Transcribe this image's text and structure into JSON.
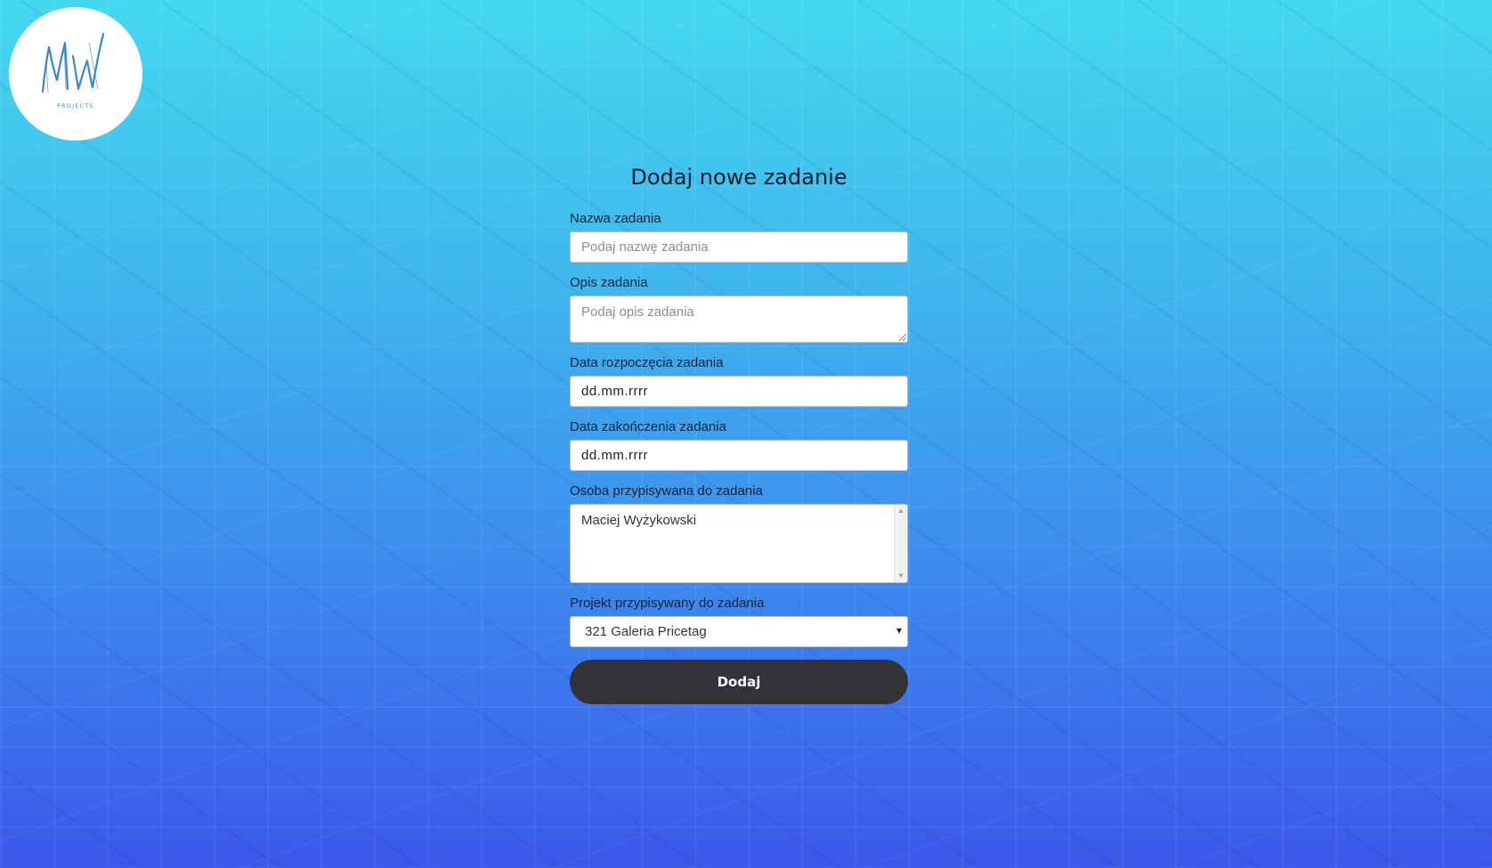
{
  "logo": {
    "monogram": "MW",
    "subtitle": "PROJECTS"
  },
  "form": {
    "title": "Dodaj nowe zadanie",
    "name": {
      "label": "Nazwa zadania",
      "placeholder": "Podaj nazwę zadania"
    },
    "description": {
      "label": "Opis zadania",
      "placeholder": "Podaj opis zadania"
    },
    "start_date": {
      "label": "Data rozpoczęcia zadania",
      "value": "dd.mm.rrrr"
    },
    "end_date": {
      "label": "Data zakończenia zadania",
      "value": "dd.mm.rrrr"
    },
    "assignee": {
      "label": "Osoba przypisywana do zadania",
      "options": [
        "Maciej Wyżykowski"
      ]
    },
    "project": {
      "label": "Projekt przypisywany do zadania",
      "selected": "321 Galeria Pricetag"
    },
    "submit_label": "Dodaj"
  },
  "colors": {
    "background_top": "#44d8ef",
    "background_bottom": "#3a58e9",
    "button": "#333236",
    "logo_ink": "#3a86c8"
  },
  "icons": {
    "resize_grip": "resize-grip-icon",
    "select_arrow": "chevron-down-icon",
    "scroll_up": "scroll-up-icon",
    "scroll_down": "scroll-down-icon"
  }
}
